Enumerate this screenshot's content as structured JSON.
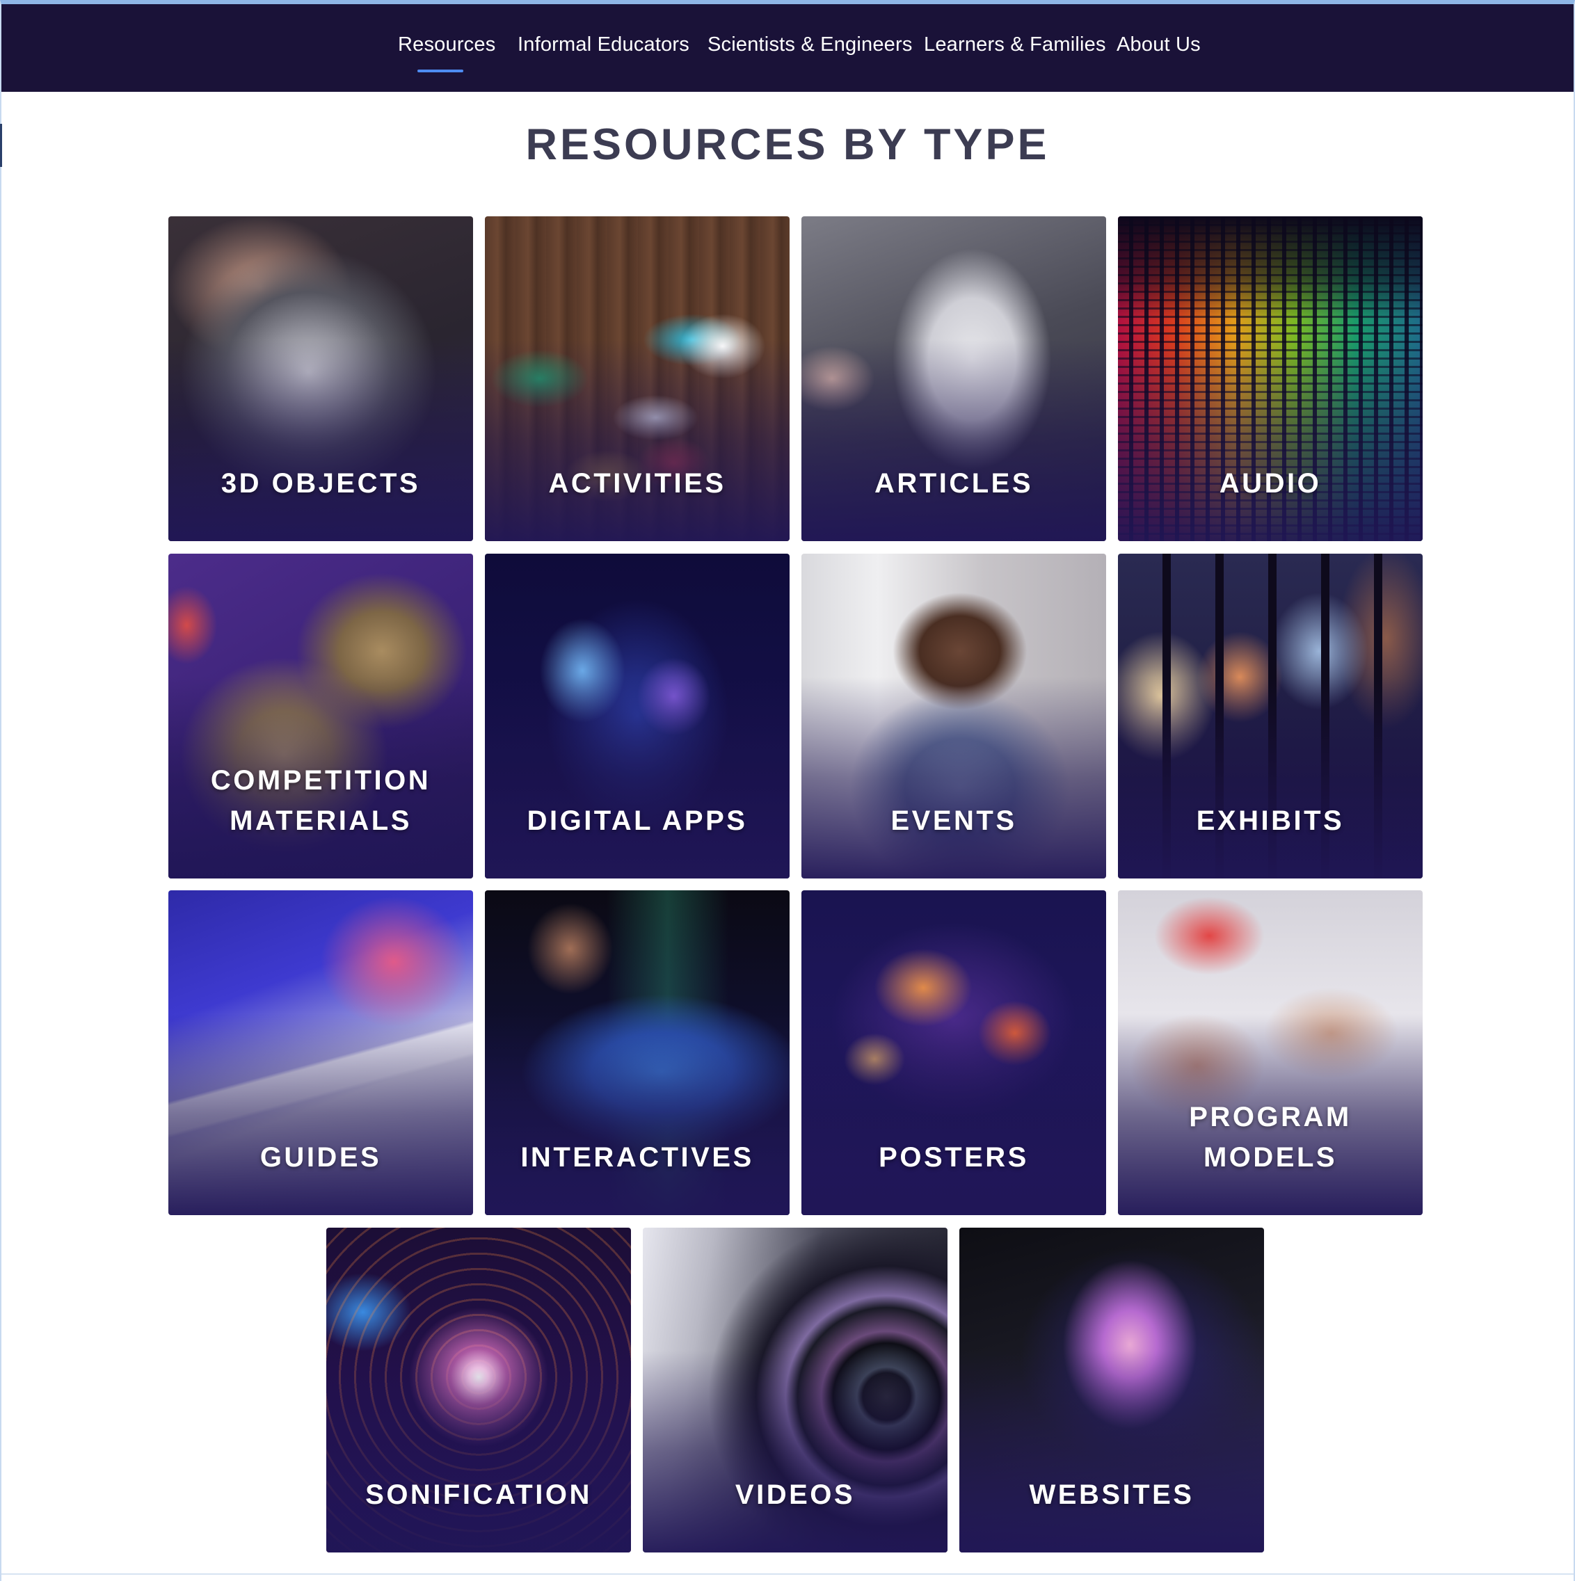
{
  "nav": {
    "items": [
      {
        "label": "Resources",
        "active": true
      },
      {
        "label": "Informal Educators",
        "active": false
      },
      {
        "label": "Scientists & Engineers",
        "active": false
      },
      {
        "label": "Learners & Families",
        "active": false
      },
      {
        "label": "About Us",
        "active": false
      }
    ],
    "colors": {
      "background": "#1a1238",
      "active_underline": "#4e8cf2",
      "text": "#ffffff"
    }
  },
  "main": {
    "title": "RESOURCES BY TYPE",
    "tiles": [
      {
        "label": "3D OBJECTS",
        "image": "3d-printed-object-image"
      },
      {
        "label": "ACTIVITIES",
        "image": "craft-activities-image"
      },
      {
        "label": "ARTICLES",
        "image": "tablet-article-image"
      },
      {
        "label": "AUDIO",
        "image": "audio-equalizer-image"
      },
      {
        "label": "COMPETITION\nMATERIALS",
        "image": "olympiad-medals-image"
      },
      {
        "label": "DIGITAL APPS",
        "image": "digital-apps-image"
      },
      {
        "label": "EVENTS",
        "image": "person-with-headphones-image"
      },
      {
        "label": "EXHIBITS",
        "image": "space-exhibit-image"
      },
      {
        "label": "GUIDES",
        "image": "booklets-image"
      },
      {
        "label": "INTERACTIVES",
        "image": "touchscreen-image"
      },
      {
        "label": "POSTERS",
        "image": "nebula-poster-image"
      },
      {
        "label": "PROGRAM\nMODELS",
        "image": "kids-drawing-image"
      },
      {
        "label": "SONIFICATION",
        "image": "sound-waves-image"
      },
      {
        "label": "VIDEOS",
        "image": "camera-lens-image"
      },
      {
        "label": "WEBSITES",
        "image": "laptop-galaxy-image"
      }
    ],
    "colors": {
      "title": "#3c3c52",
      "tile_overlay": "#20165a",
      "tile_label": "#ffffff"
    }
  }
}
